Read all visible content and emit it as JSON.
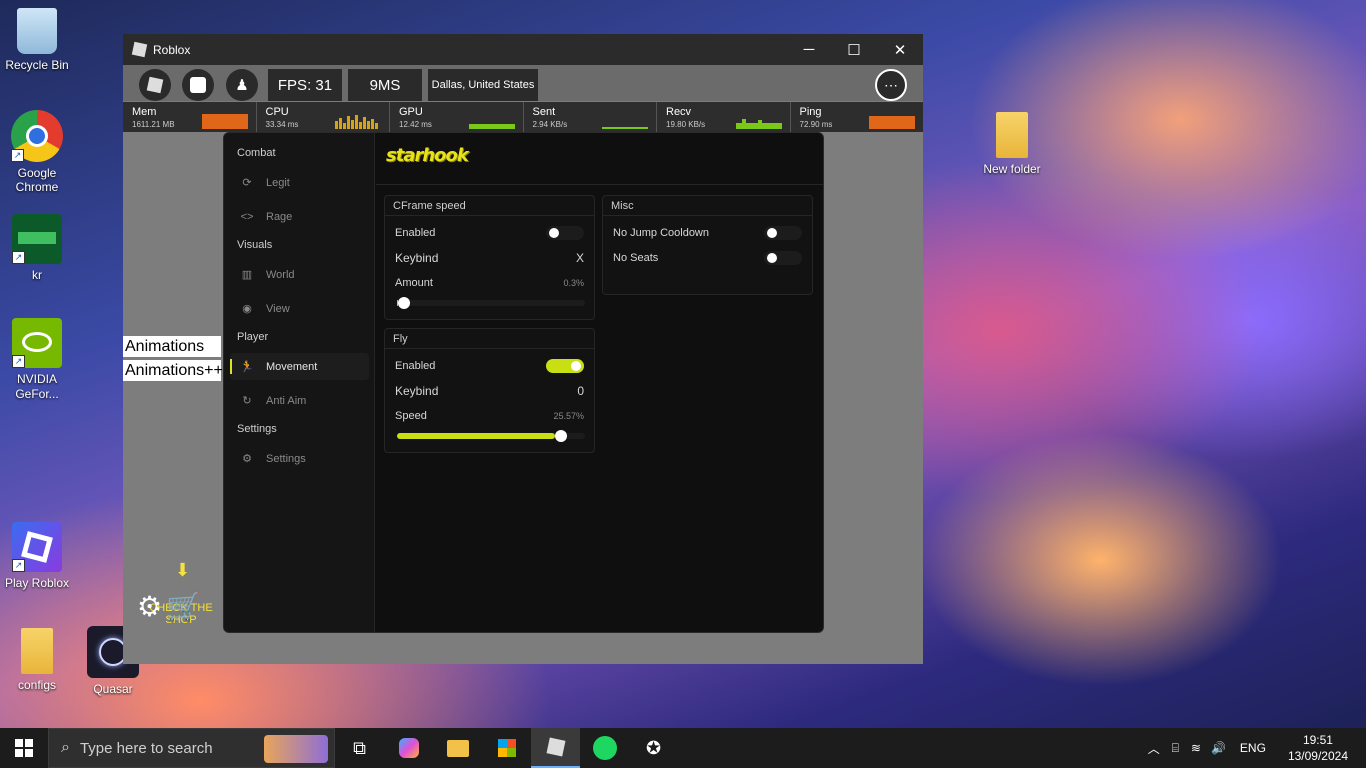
{
  "desktop": {
    "icons": [
      {
        "label": "Recycle Bin"
      },
      {
        "label": "Google Chrome"
      },
      {
        "label": "kr"
      },
      {
        "label": "NVIDIA GeFor..."
      },
      {
        "label": "Play Roblox"
      },
      {
        "label": "configs"
      },
      {
        "label": "Quasar"
      },
      {
        "label": "New folder"
      }
    ]
  },
  "window": {
    "title": "Roblox",
    "controls": {
      "minimize": "─",
      "maximize": "☐",
      "close": "✕"
    }
  },
  "topbar": {
    "fps": "FPS: 31",
    "ping": "9MS",
    "server": "Dallas, United States"
  },
  "stats": [
    {
      "label": "Mem",
      "value": "1611.21 MB",
      "color": "#e0661a"
    },
    {
      "label": "CPU",
      "value": "33.34 ms",
      "color": "#d6a21a"
    },
    {
      "label": "GPU",
      "value": "12.42 ms",
      "color": "#7ac81a"
    },
    {
      "label": "Sent",
      "value": "2.94 KB/s",
      "color": "#7ac81a"
    },
    {
      "label": "Recv",
      "value": "19.80 KB/s",
      "color": "#7ac81a"
    },
    {
      "label": "Ping",
      "value": "72.90 ms",
      "color": "#e0661a"
    }
  ],
  "game": {
    "animations": "Animations",
    "animations_pp": "Animations++",
    "shop_hint": "CHECK THE SHOP"
  },
  "panel": {
    "brand": "starhook",
    "sidebar": {
      "sections": [
        {
          "title": "Combat",
          "items": [
            {
              "label": "Legit",
              "icon": "refresh-icon"
            },
            {
              "label": "Rage",
              "icon": "code-icon"
            }
          ]
        },
        {
          "title": "Visuals",
          "items": [
            {
              "label": "World",
              "icon": "map-icon"
            },
            {
              "label": "View",
              "icon": "eye-icon"
            }
          ]
        },
        {
          "title": "Player",
          "items": [
            {
              "label": "Movement",
              "icon": "running-icon",
              "active": true
            },
            {
              "label": "Anti Aim",
              "icon": "rotate-icon"
            }
          ]
        },
        {
          "title": "Settings",
          "items": [
            {
              "label": "Settings",
              "icon": "gear-icon"
            }
          ]
        }
      ]
    },
    "cframe": {
      "title": "CFrame speed",
      "enabled_label": "Enabled",
      "enabled": false,
      "keybind_label": "Keybind",
      "keybind": "X",
      "amount_label": "Amount",
      "amount": "0.3%",
      "amount_fraction": 0.003
    },
    "fly": {
      "title": "Fly",
      "enabled_label": "Enabled",
      "enabled": true,
      "keybind_label": "Keybind",
      "keybind": "0",
      "speed_label": "Speed",
      "speed": "25.57%",
      "speed_fraction": 0.84
    },
    "misc": {
      "title": "Misc",
      "no_jump_label": "No Jump Cooldown",
      "no_jump": false,
      "no_seats_label": "No Seats",
      "no_seats": false
    },
    "accent": "#c8df14"
  },
  "taskbar": {
    "search_placeholder": "Type here to search",
    "language": "ENG",
    "time": "19:51",
    "date": "13/09/2024"
  }
}
